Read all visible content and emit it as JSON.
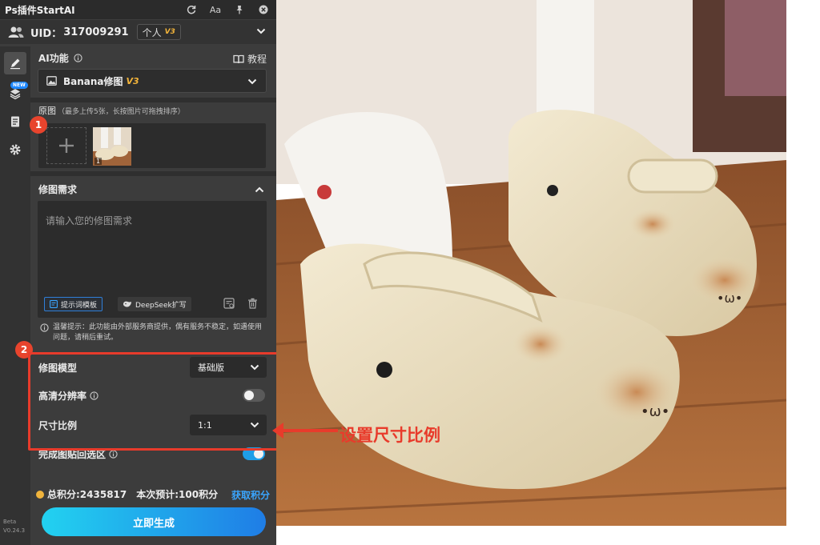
{
  "titlebar": {
    "title": "Ps插件StartAI",
    "icons": [
      "refresh-icon",
      "text-size-icon",
      "pin-icon",
      "close-icon"
    ],
    "text_size_label": "Aa"
  },
  "user": {
    "uid_label": "UID：",
    "uid_value": "317009291",
    "tier": "个人",
    "tier_version": "V3"
  },
  "sidebar": {
    "items": [
      "brush-icon",
      "layers-icon",
      "document-icon",
      "settings-icon"
    ],
    "new_badge": "NEW",
    "version_line1": "Beta",
    "version_line2": "V0.24.3"
  },
  "ai": {
    "section_title": "AI功能",
    "tutorial_label": "教程",
    "model_name": "Banana修图",
    "model_version": "V3"
  },
  "original": {
    "title": "原图",
    "hint": "（最多上传5张，长按图片可拖拽排序）",
    "thumb_index": "1"
  },
  "request": {
    "title": "修图需求",
    "placeholder": "请输入您的修图需求",
    "template_button": "提示词模板",
    "deepseek_button": "DeepSeek扩写"
  },
  "notice": "温馨提示：此功能由外部服务商提供，偶有服务不稳定，如遇使用问题，请稍后重试。",
  "options": {
    "model_label": "修图模型",
    "model_value": "基础版",
    "hd_label": "高清分辨率",
    "hd_on": false,
    "ratio_label": "尺寸比例",
    "ratio_value": "1:1",
    "paste_label": "完成图贴回选区",
    "paste_on": true
  },
  "steps": [
    "1",
    "2"
  ],
  "footer": {
    "total_points": "总积分:2435817",
    "estimate": "本次预计:100积分",
    "get_points": "获取积分",
    "generate": "立即生成"
  },
  "annotation": "设置尺寸比例",
  "colors": {
    "panel_bg": "#3c3c3c",
    "accent_blue": "#1e9ee8",
    "highlight_red": "#e83b2b",
    "version_gold": "#f3b43a"
  }
}
